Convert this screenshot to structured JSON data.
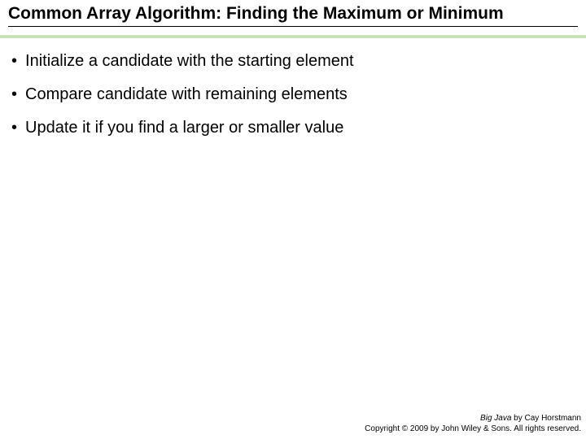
{
  "title": "Common Array Algorithm: Finding the Maximum or Minimum",
  "bullets": [
    "Initialize a candidate with the starting element",
    "Compare candidate with remaining elements",
    "Update it if you find a larger or smaller value"
  ],
  "footer": {
    "book": "Big Java",
    "byline": " by Cay Horstmann",
    "copyright": "Copyright © 2009 by John Wiley & Sons. All rights reserved."
  }
}
